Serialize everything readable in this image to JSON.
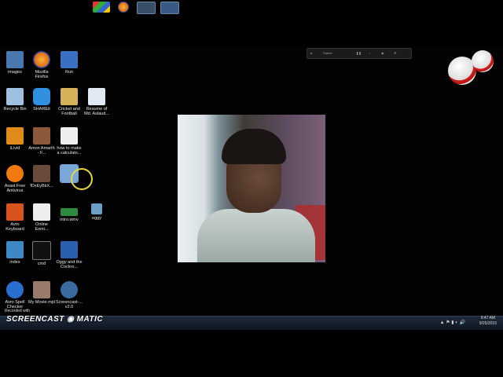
{
  "desktop_icons": [
    {
      "label": "images",
      "color": "#4a78b0"
    },
    {
      "label": "Mozilla Firefox",
      "color": "#e06a1a"
    },
    {
      "label": "Run",
      "color": "#3a6fc4"
    },
    {
      "label": "Recycle Bin",
      "color": "#9fc0de"
    },
    {
      "label": "SHAREit",
      "color": "#2f8fe0"
    },
    {
      "label": "Cricket and Football",
      "color": "#d7b05a"
    },
    {
      "label": "Resume of Md. Aslaud...",
      "color": "#dfe8f3"
    },
    {
      "label": "iLivid",
      "color": "#e08a1a"
    },
    {
      "label": "Amon Amarth - F...",
      "color": "#8a5a3a"
    },
    {
      "label": "how to make a calculato...",
      "color": "#eeeeee"
    },
    {
      "label": "Avast Free Antivirus",
      "color": "#f07a10"
    },
    {
      "label": "fDxEyBkX...",
      "color": "#6a4a3a"
    },
    {
      "label": "",
      "color": "#7aa7d6"
    },
    {
      "label": "Avro Keyboard",
      "color": "#d9531e"
    },
    {
      "label": "Online Exmi...",
      "color": "#eeeeee"
    },
    {
      "label": "intro.wmv",
      "color": "#2e8b3e"
    },
    {
      "label": "eggy",
      "color": "#6aa0c8"
    },
    {
      "label": "index",
      "color": "#3c89c6"
    },
    {
      "label": "cmd",
      "color": "#111111"
    },
    {
      "label": "Oggy and the Cockro...",
      "color": "#2b5fb0"
    },
    {
      "label": "Avro Spell Checker",
      "color": "#2a6fd0"
    },
    {
      "label": "My Movie.mpl",
      "color": "#9a7a6a"
    },
    {
      "label": "Screencast-... v2.0",
      "color": "#3a6aa0"
    }
  ],
  "watermark": {
    "top_text": "Recorded with",
    "brand": "SCREENCAST ◉ MATIC"
  },
  "recorder": {
    "status": "Starter"
  },
  "clock": {
    "time": "9:47 AM",
    "date": "9/25/2015"
  },
  "taskbar_apps": [
    {
      "name": "chrome",
      "color": "#e6b800"
    },
    {
      "name": "firefox",
      "color": "#e06a1a"
    },
    {
      "name": "photo-viewer",
      "color": "#5a5a5a"
    },
    {
      "name": "screencast",
      "color": "#4a8fd6"
    }
  ]
}
